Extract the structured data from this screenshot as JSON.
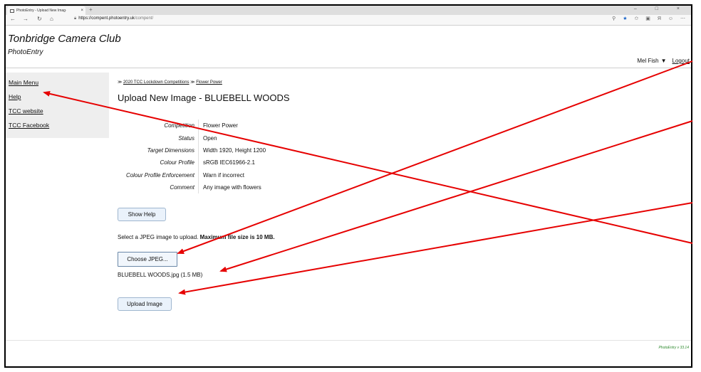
{
  "browser": {
    "tab_title": "PhotoEntry - Upload New Imag·",
    "tab_close": "×",
    "new_tab": "+",
    "window_controls": "– □ ×",
    "url_host": "https://compent.photoentry.uk",
    "url_path": "/compent/"
  },
  "site": {
    "title": "Tonbridge Camera Club",
    "subtitle": "PhotoEntry"
  },
  "user": {
    "name": "Mel Fish",
    "caret": "▼",
    "logout": "Logout"
  },
  "sidebar": {
    "items": [
      {
        "label": "Main Menu"
      },
      {
        "label": "Help"
      },
      {
        "label": "TCC website"
      },
      {
        "label": "TCC Facebook"
      }
    ]
  },
  "breadcrumb": {
    "sep": "≫",
    "parts": [
      "2020 TCC Lockdown Competitions",
      "Flower Power"
    ]
  },
  "page": {
    "heading": "Upload New Image - BLUEBELL WOODS"
  },
  "details": [
    {
      "label": "Competition",
      "value": "Flower Power"
    },
    {
      "label": "Status",
      "value": "Open"
    },
    {
      "label": "Target Dimensions",
      "value": "Width 1920, Height 1200"
    },
    {
      "label": "Colour Profile",
      "value": "sRGB IEC61966-2.1"
    },
    {
      "label": "Colour Profile Enforcement",
      "value": "Warn if incorrect"
    },
    {
      "label": "Comment",
      "value": "Any image with flowers"
    }
  ],
  "buttons": {
    "show_help": "Show Help",
    "choose_jpeg": "Choose JPEG...",
    "upload_image": "Upload Image"
  },
  "upload": {
    "instruction": "Select a JPEG image to upload.",
    "max_size": "Maximum file size is 10 MB.",
    "file_info": "BLUEBELL WOODS.jpg (1.5 MB)"
  },
  "footer": {
    "version": "PhotoEntry v 33.14"
  },
  "colors": {
    "arrow": "#e60000",
    "button_bg": "#eaf2fb",
    "version_text": "#2f8a2f"
  }
}
